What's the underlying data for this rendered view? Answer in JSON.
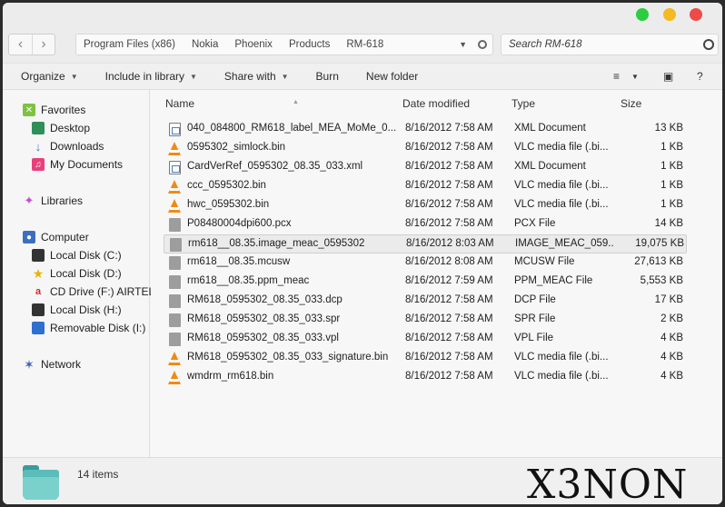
{
  "window": {
    "controls": [
      {
        "name": "green",
        "color": "#2ecc40"
      },
      {
        "name": "yellow",
        "color": "#f5b921"
      },
      {
        "name": "red",
        "color": "#ef4a4a"
      }
    ]
  },
  "nav": {
    "back_icon": "chevron-left-icon",
    "forward_icon": "chevron-right-icon"
  },
  "address": {
    "crumbs": [
      "Program Files (x86)",
      "Nokia",
      "Phoenix",
      "Products",
      "RM-618"
    ]
  },
  "search": {
    "placeholder": "Search RM-618"
  },
  "toolbar": {
    "organize": "Organize",
    "include": "Include in library",
    "share": "Share with",
    "burn": "Burn",
    "new_folder": "New folder",
    "help": "?"
  },
  "sidebar": {
    "favorites": "Favorites",
    "desktop": "Desktop",
    "downloads": "Downloads",
    "documents": "My Documents",
    "libraries": "Libraries",
    "computer": "Computer",
    "disk_c": "Local Disk (C:)",
    "disk_d": "Local Disk (D:)",
    "cd_f": "CD Drive (F:) AIRTEL",
    "disk_h": "Local Disk (H:)",
    "removable": "Removable Disk (I:)",
    "network": "Network"
  },
  "columns": {
    "name": "Name",
    "date": "Date modified",
    "type": "Type",
    "size": "Size"
  },
  "files": [
    {
      "icon": "xml",
      "name": "040_084800_RM618_label_MEA_MoMe_0...",
      "date": "8/16/2012 7:58 AM",
      "type": "XML Document",
      "size": "13 KB"
    },
    {
      "icon": "vlc",
      "name": "0595302_simlock.bin",
      "date": "8/16/2012 7:58 AM",
      "type": "VLC media file (.bi...",
      "size": "1 KB"
    },
    {
      "icon": "xml",
      "name": "CardVerRef_0595302_08.35_033.xml",
      "date": "8/16/2012 7:58 AM",
      "type": "XML Document",
      "size": "1 KB"
    },
    {
      "icon": "vlc",
      "name": "ccc_0595302.bin",
      "date": "8/16/2012 7:58 AM",
      "type": "VLC media file (.bi...",
      "size": "1 KB"
    },
    {
      "icon": "vlc",
      "name": "hwc_0595302.bin",
      "date": "8/16/2012 7:58 AM",
      "type": "VLC media file (.bi...",
      "size": "1 KB"
    },
    {
      "icon": "doc",
      "name": "P08480004dpi600.pcx",
      "date": "8/16/2012 7:58 AM",
      "type": "PCX File",
      "size": "14 KB"
    },
    {
      "icon": "doc",
      "name": "rm618__08.35.image_meac_0595302",
      "date": "8/16/2012 8:03 AM",
      "type": "IMAGE_MEAC_059...",
      "size": "19,075 KB",
      "selected": true
    },
    {
      "icon": "doc",
      "name": "rm618__08.35.mcusw",
      "date": "8/16/2012 8:08 AM",
      "type": "MCUSW File",
      "size": "27,613 KB"
    },
    {
      "icon": "doc",
      "name": "rm618__08.35.ppm_meac",
      "date": "8/16/2012 7:59 AM",
      "type": "PPM_MEAC File",
      "size": "5,553 KB"
    },
    {
      "icon": "doc",
      "name": "RM618_0595302_08.35_033.dcp",
      "date": "8/16/2012 7:58 AM",
      "type": "DCP File",
      "size": "17 KB"
    },
    {
      "icon": "doc",
      "name": "RM618_0595302_08.35_033.spr",
      "date": "8/16/2012 7:58 AM",
      "type": "SPR File",
      "size": "2 KB"
    },
    {
      "icon": "doc",
      "name": "RM618_0595302_08.35_033.vpl",
      "date": "8/16/2012 7:58 AM",
      "type": "VPL File",
      "size": "4 KB"
    },
    {
      "icon": "vlc",
      "name": "RM618_0595302_08.35_033_signature.bin",
      "date": "8/16/2012 7:58 AM",
      "type": "VLC media file (.bi...",
      "size": "4 KB"
    },
    {
      "icon": "vlc",
      "name": "wmdrm_rm618.bin",
      "date": "8/16/2012 7:58 AM",
      "type": "VLC media file (.bi...",
      "size": "4 KB"
    }
  ],
  "status": {
    "count": "14 items"
  },
  "watermark": "X3NON"
}
